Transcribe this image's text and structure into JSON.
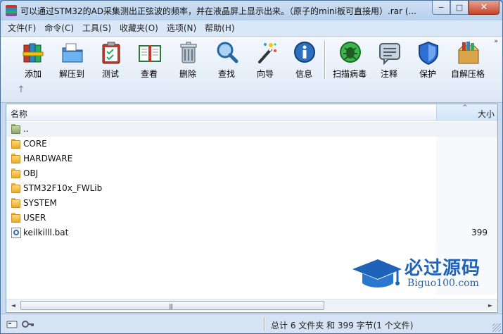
{
  "window": {
    "title": "可以通过STM32的AD采集测出正弦波的频率，并在液晶屏上显示出来。（原子的mini板可直接用）.rar (...",
    "controls": {
      "minimize": "−",
      "maximize": "□",
      "close": "✕"
    }
  },
  "menu": [
    {
      "label": "文件(F)"
    },
    {
      "label": "命令(C)"
    },
    {
      "label": "工具(S)"
    },
    {
      "label": "收藏夹(O)"
    },
    {
      "label": "选项(N)"
    },
    {
      "label": "帮助(H)"
    }
  ],
  "toolbar": [
    {
      "label": "添加",
      "icon": "books-add-icon"
    },
    {
      "label": "解压到",
      "icon": "folder-extract-icon"
    },
    {
      "label": "测试",
      "icon": "clipboard-check-icon"
    },
    {
      "label": "查看",
      "icon": "open-book-icon"
    },
    {
      "label": "删除",
      "icon": "trash-icon"
    },
    {
      "label": "查找",
      "icon": "magnifier-icon"
    },
    {
      "label": "向导",
      "icon": "magic-wand-icon"
    },
    {
      "label": "信息",
      "icon": "info-icon"
    },
    {
      "label": "扫描病毒",
      "icon": "virus-scan-icon"
    },
    {
      "label": "注释",
      "icon": "comment-icon"
    },
    {
      "label": "保护",
      "icon": "shield-icon"
    },
    {
      "label": "自解压格",
      "icon": "sfx-box-icon"
    }
  ],
  "nav": {
    "up_arrow": "↑",
    "more": "»"
  },
  "list": {
    "columns": {
      "name": "名称",
      "size": "大小",
      "sort_indicator": "^"
    },
    "rows": [
      {
        "name": "..",
        "type": "parent",
        "size": ""
      },
      {
        "name": "CORE",
        "type": "folder",
        "size": ""
      },
      {
        "name": "HARDWARE",
        "type": "folder",
        "size": ""
      },
      {
        "name": "OBJ",
        "type": "folder",
        "size": ""
      },
      {
        "name": "STM32F10x_FWLib",
        "type": "folder",
        "size": ""
      },
      {
        "name": "SYSTEM",
        "type": "folder",
        "size": ""
      },
      {
        "name": "USER",
        "type": "folder",
        "size": ""
      },
      {
        "name": "keilkilll.bat",
        "type": "bat",
        "size": "399"
      }
    ]
  },
  "watermark": {
    "title": "必过源码",
    "subtitle": "Biguo100.com"
  },
  "scroll": {
    "left": "◄",
    "right": "►",
    "grip": "|||"
  },
  "status": {
    "text": "总计 6 文件夹 和 399 字节(1 个文件)"
  }
}
